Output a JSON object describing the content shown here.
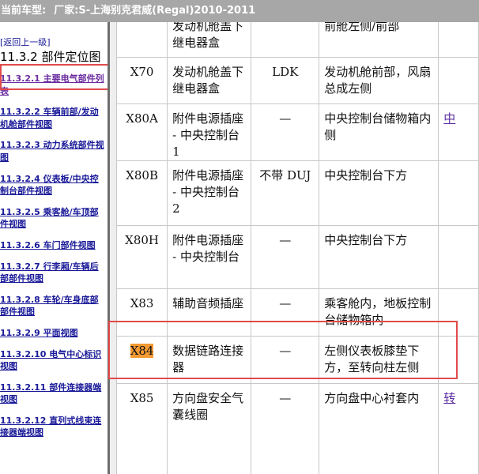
{
  "header": {
    "current_vehicle_label": "当前车型:",
    "current_vehicle_value": "厂家:S-上海别克君威(Regal)2010-2011"
  },
  "sidebar": {
    "back_link": "[返回上一级]",
    "section_title": "11.3.2 部件定位图",
    "links": [
      "11.3.2.1 主要电气部件列表",
      "11.3.2.2 车辆前部/发动机舱部件视图",
      "11.3.2.3 动力系统部件视图",
      "11.3.2.4 仪表板/中央控制台部件视图",
      "11.3.2.5 乘客舱/车顶部件视图",
      "11.3.2.6 车门部件视图",
      "11.3.2.7 行李厢/车辆后部部件视图",
      "11.3.2.8 车轮/车身底部部件视图",
      "11.3.2.9 平面视图",
      "11.3.2.10 电气中心标识视图",
      "11.3.2.11 部件连接器端视图",
      "11.3.2.12 直列式线束连接器端视图"
    ]
  },
  "table": {
    "rows": [
      {
        "code": "",
        "name": "发动机舱盖下继电器盒",
        "option": "",
        "location": "前舱左侧/前部",
        "link": ""
      },
      {
        "code": "X70",
        "name": "发动机舱盖下继电器盒",
        "option": "LDK",
        "location": "发动机舱前部，风扇总成左侧",
        "link": ""
      },
      {
        "code": "X80A",
        "name": "附件电源插座 - 中央控制台 1",
        "option": "—",
        "location": "中央控制台储物箱内侧",
        "link": "中"
      },
      {
        "code": "X80B",
        "name": "附件电源插座 - 中央控制台 2",
        "option": "不带 DUJ",
        "location": "中央控制台下方",
        "link": ""
      },
      {
        "code": "X80H",
        "name": "附件电源插座 - 中央控制台",
        "option": "—",
        "location": "中央控制台下方",
        "link": ""
      },
      {
        "code": "X83",
        "name": "辅助音频插座",
        "option": "—",
        "location": "乘客舱内，地板控制台储物箱内",
        "link": ""
      },
      {
        "code": "X84",
        "name": "数据链路连接器",
        "option": "—",
        "location": "左侧仪表板膝垫下方，至转向柱左侧",
        "link": ""
      },
      {
        "code": "X85",
        "name": "方向盘安全气囊线圈",
        "option": "—",
        "location": "方向盘中心衬套内",
        "link": "转"
      }
    ]
  }
}
